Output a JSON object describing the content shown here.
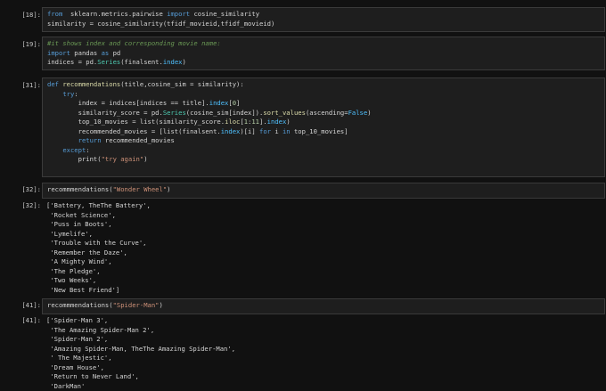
{
  "cells": [
    {
      "prompt": "[18]:",
      "lines": [
        [
          [
            "k",
            "from"
          ],
          [
            "",
            "  sklearn.metrics.pairwise "
          ],
          [
            "k",
            "import"
          ],
          [
            "",
            " cosine_similarity"
          ]
        ],
        [
          [
            "",
            "similarity = cosine_similarity(tfidf_movieid,tfidf_movieid)"
          ]
        ]
      ]
    },
    {
      "prompt": "[19]:",
      "lines": [
        [
          [
            "c",
            "#it shows index and corresponding movie name:"
          ]
        ],
        [
          [
            "k",
            "import"
          ],
          [
            "",
            " pandas "
          ],
          [
            "k",
            "as"
          ],
          [
            "",
            " pd"
          ]
        ],
        [
          [
            "",
            "indices = pd."
          ],
          [
            "t",
            "Series"
          ],
          [
            "",
            "(finalsent."
          ],
          [
            "kf",
            "index"
          ],
          [
            "",
            ")"
          ]
        ]
      ]
    },
    {
      "prompt": "[31]:",
      "lines": [
        [
          [
            "k",
            "def"
          ],
          [
            "",
            " "
          ],
          [
            "f",
            "recommendations"
          ],
          [
            "",
            "(title,cosine_sim = similarity):"
          ]
        ],
        [
          [
            "",
            "    "
          ],
          [
            "k",
            "try"
          ],
          [
            "",
            ":"
          ]
        ],
        [
          [
            "",
            "        index = indices[indices == title]."
          ],
          [
            "kf",
            "index"
          ],
          [
            "",
            "["
          ],
          [
            "n",
            "0"
          ],
          [
            "",
            "]"
          ]
        ],
        [
          [
            "",
            "        similarity_score = pd."
          ],
          [
            "t",
            "Series"
          ],
          [
            "",
            "(cosine_sim[index])."
          ],
          [
            "f",
            "sort_values"
          ],
          [
            "",
            "(ascending="
          ],
          [
            "kf",
            "False"
          ],
          [
            "",
            ")"
          ]
        ],
        [
          [
            "",
            "        top_10_movies = list(similarity_score."
          ],
          [
            "f",
            "iloc"
          ],
          [
            "",
            "["
          ],
          [
            "n",
            "1"
          ],
          [
            "",
            ":"
          ],
          [
            "n",
            "11"
          ],
          [
            "",
            "]."
          ],
          [
            "kf",
            "index"
          ],
          [
            "",
            ")"
          ]
        ],
        [
          [
            "",
            "        recommended_movies = [list(finalsent."
          ],
          [
            "kf",
            "index"
          ],
          [
            "",
            ")[i] "
          ],
          [
            "k",
            "for"
          ],
          [
            "",
            " i "
          ],
          [
            "k",
            "in"
          ],
          [
            "",
            " top_10_movies]"
          ]
        ],
        [
          [
            "",
            "        "
          ],
          [
            "k",
            "return"
          ],
          [
            "",
            " recommended_movies"
          ]
        ],
        [
          [
            "",
            "    "
          ],
          [
            "k",
            "except"
          ],
          [
            "",
            ":"
          ]
        ],
        [
          [
            "",
            "        print("
          ],
          [
            "s",
            "\"try again\""
          ],
          [
            "",
            ")"
          ]
        ]
      ]
    },
    {
      "prompt": "[32]:",
      "lines": [
        [
          [
            "",
            "recommmendations("
          ],
          [
            "s",
            "\"Wonder Wheel\""
          ],
          [
            "",
            ")"
          ]
        ]
      ],
      "out_prompt": "[32]:",
      "output": [
        "['Battery, TheThe Battery',",
        " 'Rocket Science',",
        " 'Puss in Boots',",
        " 'Lymelife',",
        " 'Trouble with the Curve',",
        " 'Remember the Daze',",
        " 'A Mighty Wind',",
        " 'The Pledge',",
        " 'Two Weeks',",
        " 'New Best Friend']"
      ]
    },
    {
      "prompt": "[41]:",
      "lines": [
        [
          [
            "",
            "recommmendations("
          ],
          [
            "s",
            "\"Spider-Man\""
          ],
          [
            "",
            ")"
          ]
        ]
      ],
      "out_prompt": "[41]:",
      "output": [
        "['Spider-Man 3',",
        " 'The Amazing Spider-Man 2',",
        " 'Spider-Man 2',",
        " 'Amazing Spider-Man, TheThe Amazing Spider-Man',",
        " ' The Majestic',",
        " 'Dream House',",
        " 'Return to Never Land',",
        " 'DarkMan'"
      ]
    }
  ]
}
